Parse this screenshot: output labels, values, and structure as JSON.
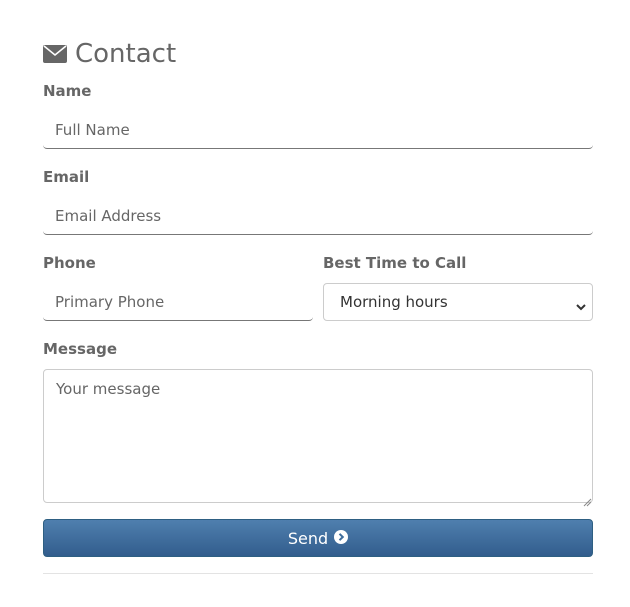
{
  "form": {
    "title": "Contact",
    "name_label": "Name",
    "name_placeholder": "Full Name",
    "email_label": "Email",
    "email_placeholder": "Email Address",
    "phone_label": "Phone",
    "phone_placeholder": "Primary Phone",
    "best_time_label": "Best Time to Call",
    "best_time_value": "Morning hours",
    "message_label": "Message",
    "message_placeholder": "Your message",
    "send_label": "Send"
  },
  "icons": {
    "title": "envelope-icon",
    "send": "circle-chevron-right-icon",
    "select": "chevron-down-icon"
  },
  "colors": {
    "button": "#3e6d9c",
    "text": "#666666"
  }
}
